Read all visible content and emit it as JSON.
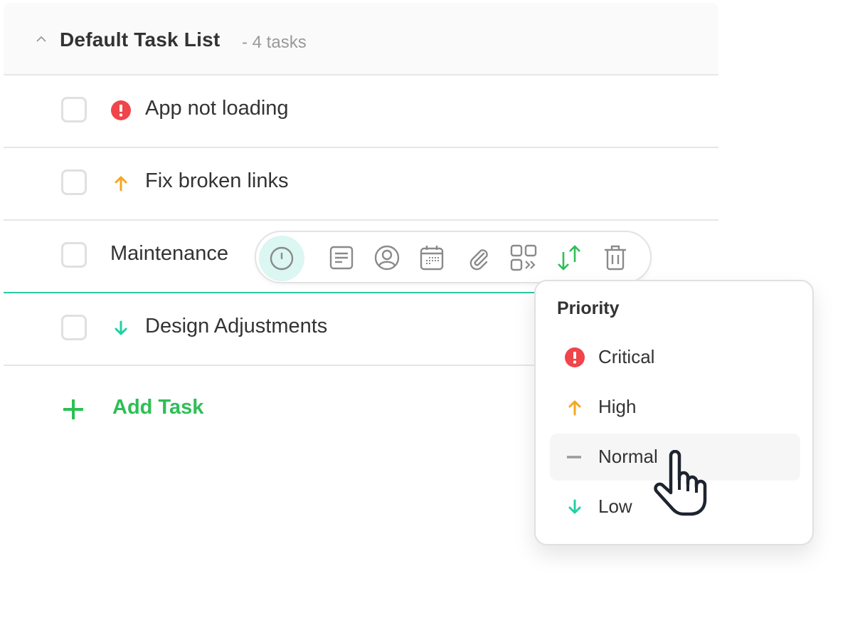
{
  "list": {
    "title": "Default Task List",
    "count_label": "- 4 tasks",
    "collapse_icon": "chevron-up-icon"
  },
  "tasks": [
    {
      "label": "App not loading",
      "priority": "Critical",
      "priority_icon": "critical-alert-icon"
    },
    {
      "label": "Fix broken links",
      "priority": "High",
      "priority_icon": "arrow-up-icon"
    },
    {
      "label": "Maintenance",
      "priority": null,
      "priority_icon": null,
      "active": true
    },
    {
      "label": "Design Adjustments",
      "priority": "Low",
      "priority_icon": "arrow-down-icon"
    }
  ],
  "add_task": {
    "label": "Add Task",
    "icon": "plus-icon"
  },
  "toolbar": {
    "buttons": [
      {
        "name": "priority",
        "icon": "priority-clock-icon",
        "active": true
      },
      {
        "name": "description",
        "icon": "document-lines-icon"
      },
      {
        "name": "assignee",
        "icon": "user-circle-icon"
      },
      {
        "name": "due-date",
        "icon": "calendar-icon"
      },
      {
        "name": "attachment",
        "icon": "paperclip-icon"
      },
      {
        "name": "move",
        "icon": "grid-move-icon"
      },
      {
        "name": "sort",
        "icon": "sort-arrows-icon"
      },
      {
        "name": "delete",
        "icon": "trash-icon"
      }
    ]
  },
  "priority_menu": {
    "title": "Priority",
    "hovered": "Normal",
    "items": [
      {
        "label": "Critical",
        "icon": "critical-alert-icon",
        "color": "#f0454b"
      },
      {
        "label": "High",
        "icon": "arrow-up-icon",
        "color": "#f5a623"
      },
      {
        "label": "Normal",
        "icon": "dash-icon",
        "color": "#9a9a9a"
      },
      {
        "label": "Low",
        "icon": "arrow-down-icon",
        "color": "#1fd1a5"
      }
    ]
  },
  "colors": {
    "accent_green": "#2dbf55",
    "active_teal": "#2ec7a7",
    "critical": "#f0454b",
    "high": "#f5a623",
    "low": "#1fd1a5"
  }
}
